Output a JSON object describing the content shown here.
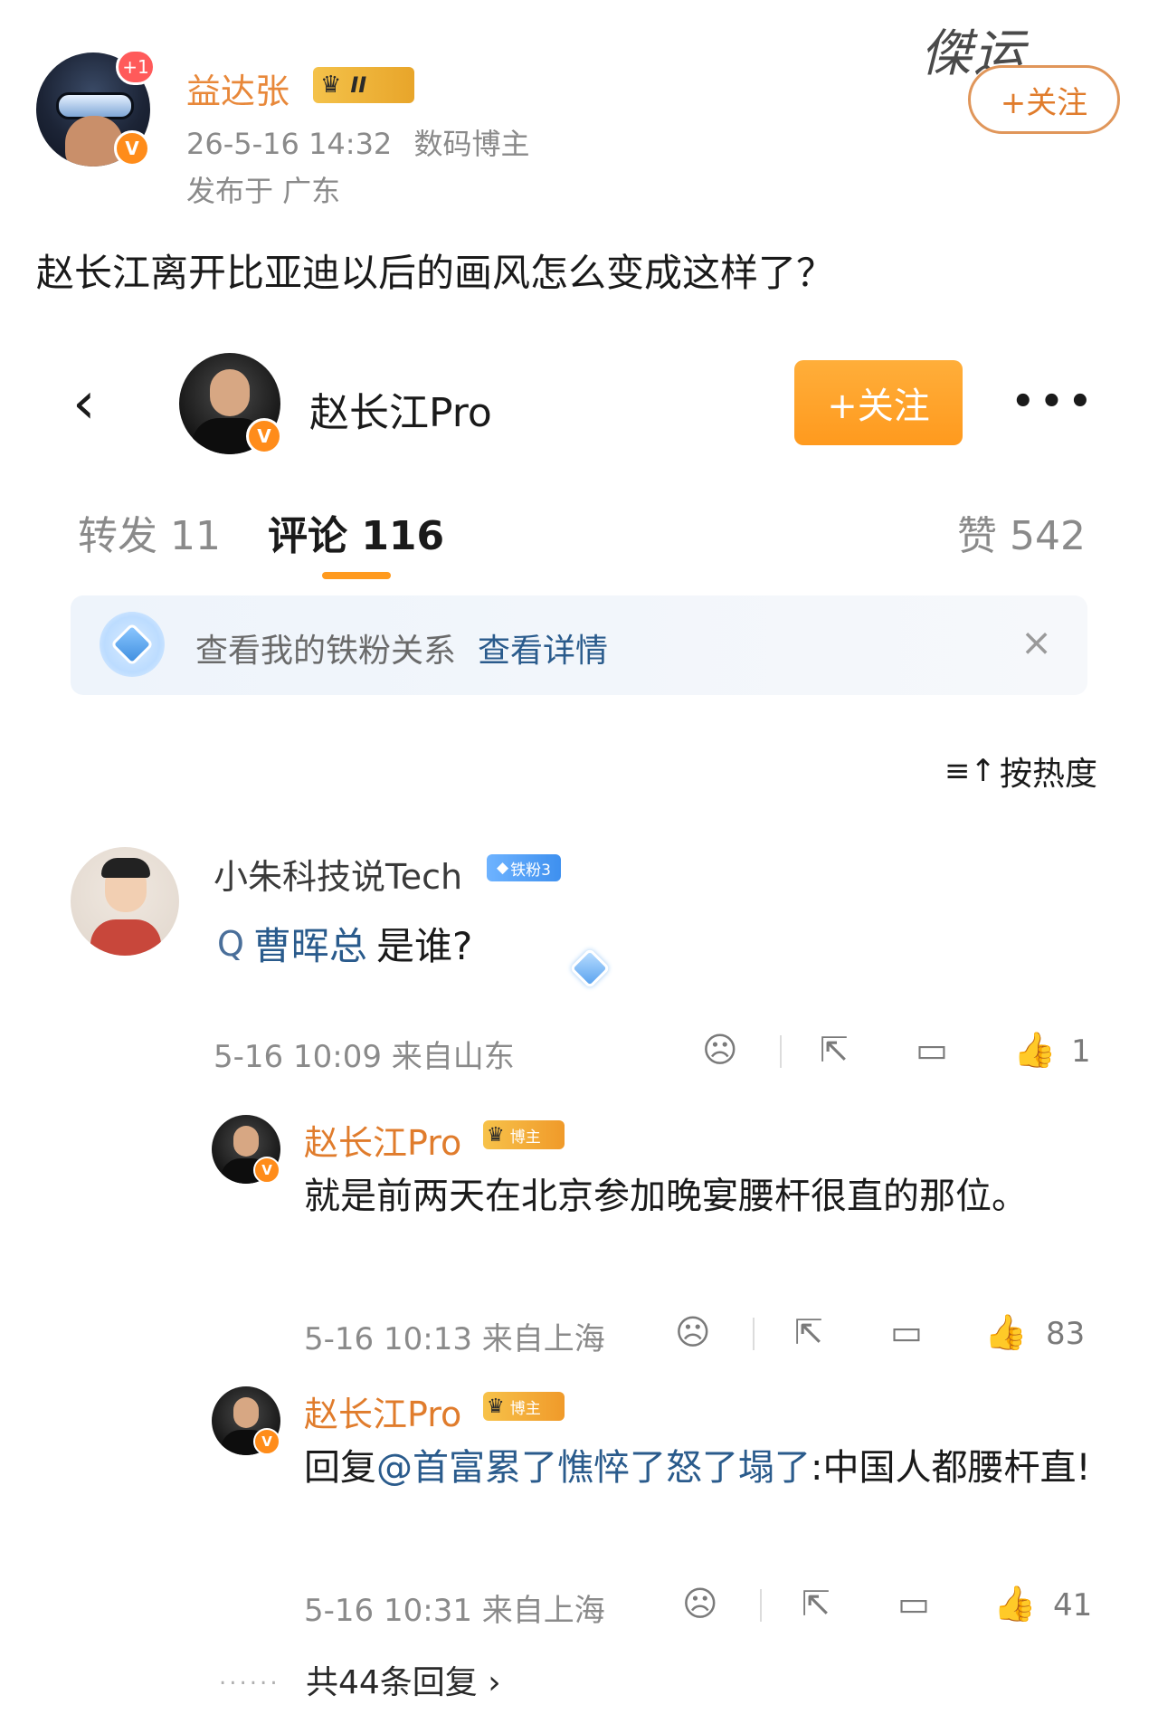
{
  "post": {
    "author": "益达张",
    "level_badge": "II",
    "new_count": "+1",
    "timestamp": "26-5-16 14:32",
    "author_role": "数码博主",
    "location": "发布于 广东",
    "follow_label": "+关注",
    "text": "赵长江离开比亚迪以后的画风怎么变成这样了？",
    "watermark_text": "傑运",
    "verified_mark": "V"
  },
  "embedded": {
    "back_icon": "chevron-left-icon",
    "account_name": "赵长江Pro",
    "follow_label": "+关注",
    "more_label": "•••",
    "tabs": {
      "repost": "转发 11",
      "comment": "评论 116",
      "like": "赞 542"
    },
    "fan_banner": {
      "text": "查看我的铁粉关系",
      "link": "查看详情",
      "close": "×"
    },
    "sort": {
      "icon": "≡↑",
      "label": "按热度"
    },
    "comment1": {
      "author": "小朱科技说Tech",
      "fan_tag": "铁粉3",
      "search_icon": "Q",
      "link_text": "曹晖总",
      "tail_text": " 是谁?",
      "time_location": "5-16 10:09  来自山东",
      "like_count": "1"
    },
    "reply1": {
      "author": "赵长江Pro",
      "tag": "博主",
      "text": "就是前两天在北京参加晚宴腰杆很直的那位。",
      "time_location": "5-16 10:13  来自上海",
      "like_count": "83"
    },
    "reply2": {
      "author": "赵长江Pro",
      "tag": "博主",
      "prefix": "回复",
      "mention": "@首富累了憔悴了怒了塌了",
      "text": ":中国人都腰杆直!",
      "time_location": "5-16 10:31  来自上海",
      "like_count": "41"
    },
    "total_replies": "共44条回复 ›",
    "total_dots": "......"
  },
  "colors": {
    "accent_orange": "#ff9a1e",
    "name_orange": "#e07c2c",
    "link_blue": "#2a5b8c",
    "meta_gray": "#8a8a8a"
  },
  "icons": {
    "dislike": "sad-face-icon",
    "share": "share-icon",
    "comment": "comment-bubble-icon",
    "like": "thumbs-up-icon"
  }
}
